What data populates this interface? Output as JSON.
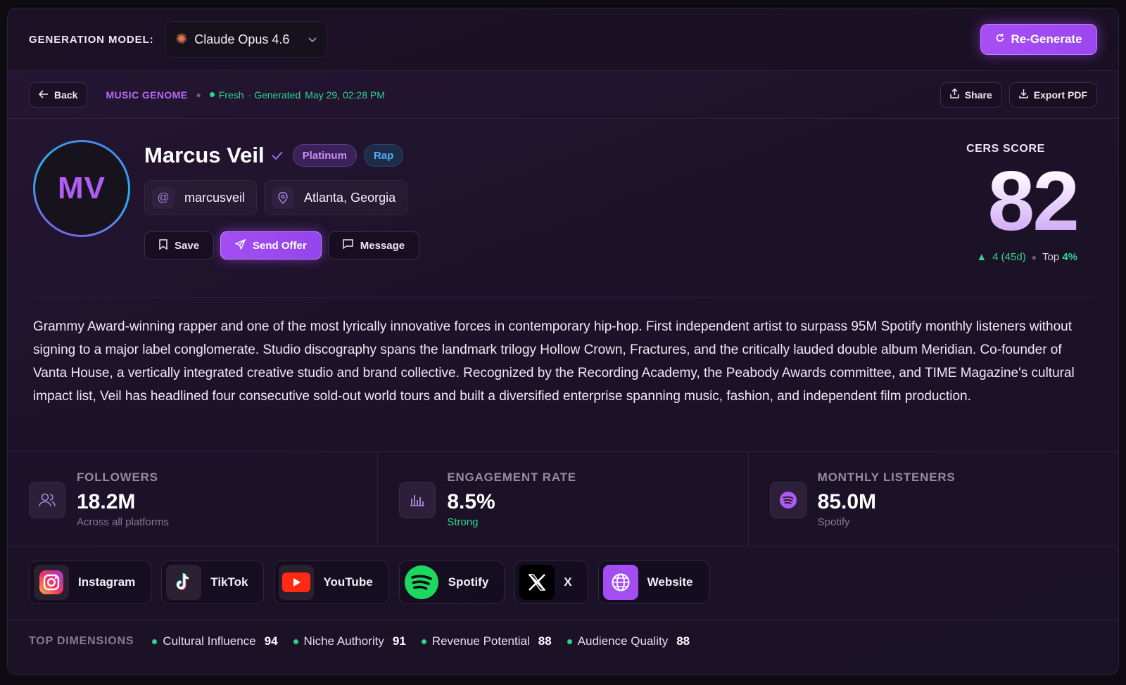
{
  "header": {
    "model_label": "GENERATION MODEL:",
    "model_name": "Claude Opus 4.6",
    "regenerate_label": "Re-Generate"
  },
  "subbar": {
    "back_label": "Back",
    "breadcrumb": "MUSIC GENOME",
    "fresh_label": "Fresh",
    "generated_label": "· Generated",
    "generated_at": "May 29, 02:28 PM",
    "share_label": "Share",
    "export_label": "Export PDF"
  },
  "profile": {
    "initials": "MV",
    "name": "Marcus Veil",
    "tags": [
      "Platinum",
      "Rap"
    ],
    "handle": "marcusveil",
    "location": "Atlanta, Georgia",
    "actions": {
      "save": "Save",
      "send_offer": "Send Offer",
      "message": "Message"
    }
  },
  "score": {
    "label": "CERS SCORE",
    "value": "82",
    "delta": "4 (45d)",
    "top_prefix": "Top",
    "top_value": "4%"
  },
  "bio": "Grammy Award-winning rapper and one of the most lyrically innovative forces in contemporary hip-hop. First independent artist to surpass 95M Spotify monthly listeners without signing to a major label conglomerate. Studio discography spans the landmark trilogy Hollow Crown, Fractures, and the critically lauded double album Meridian. Co-founder of Vanta House, a vertically integrated creative studio and brand collective. Recognized by the Recording Academy, the Peabody Awards committee, and TIME Magazine's cultural impact list, Veil has headlined four consecutive sold-out world tours and built a diversified enterprise spanning music, fashion, and independent film production.",
  "stats": [
    {
      "label": "FOLLOWERS",
      "value": "18.2M",
      "sub": "Across all platforms",
      "icon": "users-icon"
    },
    {
      "label": "ENGAGEMENT RATE",
      "value": "8.5%",
      "sub": "Strong",
      "icon": "bar-chart-icon"
    },
    {
      "label": "MONTHLY LISTENERS",
      "value": "85.0M",
      "sub": "Spotify",
      "icon": "spotify-icon"
    }
  ],
  "socials": [
    {
      "label": "Instagram",
      "icon": "instagram-icon"
    },
    {
      "label": "TikTok",
      "icon": "tiktok-icon"
    },
    {
      "label": "YouTube",
      "icon": "youtube-icon"
    },
    {
      "label": "Spotify",
      "icon": "spotify-icon"
    },
    {
      "label": "X",
      "icon": "x-icon"
    },
    {
      "label": "Website",
      "icon": "globe-icon"
    }
  ],
  "dimensions": {
    "label": "TOP DIMENSIONS",
    "items": [
      {
        "name": "Cultural Influence",
        "value": "94"
      },
      {
        "name": "Niche Authority",
        "value": "91"
      },
      {
        "name": "Revenue Potential",
        "value": "88"
      },
      {
        "name": "Audience Quality",
        "value": "88"
      }
    ]
  },
  "colors": {
    "accent": "#a74ef5",
    "positive": "#2ed38e",
    "background": "#1d1229"
  }
}
